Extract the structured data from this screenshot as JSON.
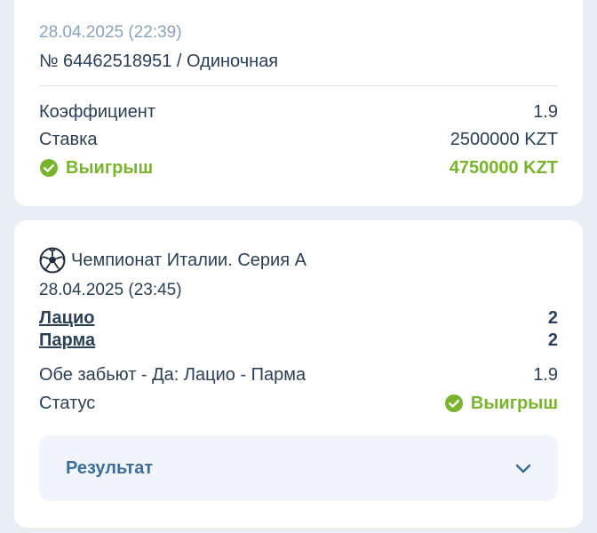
{
  "bet": {
    "datetime": "28.04.2025 (22:39)",
    "number_line": "№ 64462518951 / Одиночная",
    "coefficient_label": "Коэффициент",
    "coefficient_value": "1.9",
    "stake_label": "Ставка",
    "stake_value": "2500000 KZT",
    "win_label": "Выигрыш",
    "win_value": "4750000 KZT"
  },
  "event": {
    "league": "Чемпионат Италии. Серия А",
    "datetime": "28.04.2025 (23:45)",
    "teams": [
      {
        "name": "Лацио",
        "score": "2"
      },
      {
        "name": "Парма",
        "score": "2"
      }
    ],
    "market": "Обе забьют - Да: Лацио - Парма",
    "market_odds": "1.9",
    "status_label": "Статус",
    "status_value": "Выигрыш",
    "result_label": "Результат"
  },
  "colors": {
    "win": "#7ab32e",
    "text": "#2b4054",
    "muted": "#8ba3b8",
    "accent": "#3c6e9a"
  }
}
